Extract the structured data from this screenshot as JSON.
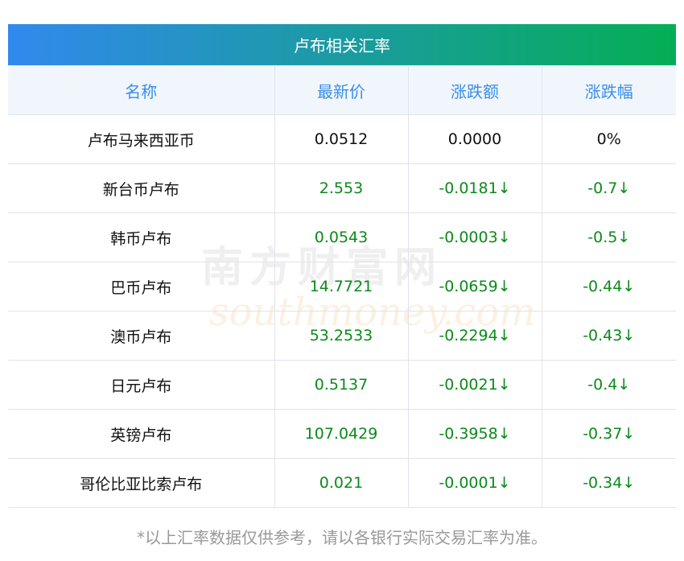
{
  "title": "卢布相关汇率",
  "headers": [
    "名称",
    "最新价",
    "涨跌额",
    "涨跌幅"
  ],
  "rows": [
    {
      "name": "卢布马来西亚币",
      "price": "0.0512",
      "change": "0.0000",
      "pct": "0%",
      "dir": "flat"
    },
    {
      "name": "新台币卢布",
      "price": "2.553",
      "change": "-0.0181↓",
      "pct": "-0.7↓",
      "dir": "down"
    },
    {
      "name": "韩币卢布",
      "price": "0.0543",
      "change": "-0.0003↓",
      "pct": "-0.5↓",
      "dir": "down"
    },
    {
      "name": "巴币卢布",
      "price": "14.7721",
      "change": "-0.0659↓",
      "pct": "-0.44↓",
      "dir": "down"
    },
    {
      "name": "澳币卢布",
      "price": "53.2533",
      "change": "-0.2294↓",
      "pct": "-0.43↓",
      "dir": "down"
    },
    {
      "name": "日元卢布",
      "price": "0.5137",
      "change": "-0.0021↓",
      "pct": "-0.4↓",
      "dir": "down"
    },
    {
      "name": "英镑卢布",
      "price": "107.0429",
      "change": "-0.3958↓",
      "pct": "-0.37↓",
      "dir": "down"
    },
    {
      "name": "哥伦比亚比索卢布",
      "price": "0.021",
      "change": "-0.0001↓",
      "pct": "-0.34↓",
      "dir": "down"
    }
  ],
  "note": "*以上汇率数据仅供参考，请以各银行实际交易汇率为准。",
  "watermark": {
    "cn": "南方财富网",
    "en": "southmoney.com"
  },
  "colors": {
    "up": "#0b8a1a",
    "header": "#3a8ee6"
  }
}
